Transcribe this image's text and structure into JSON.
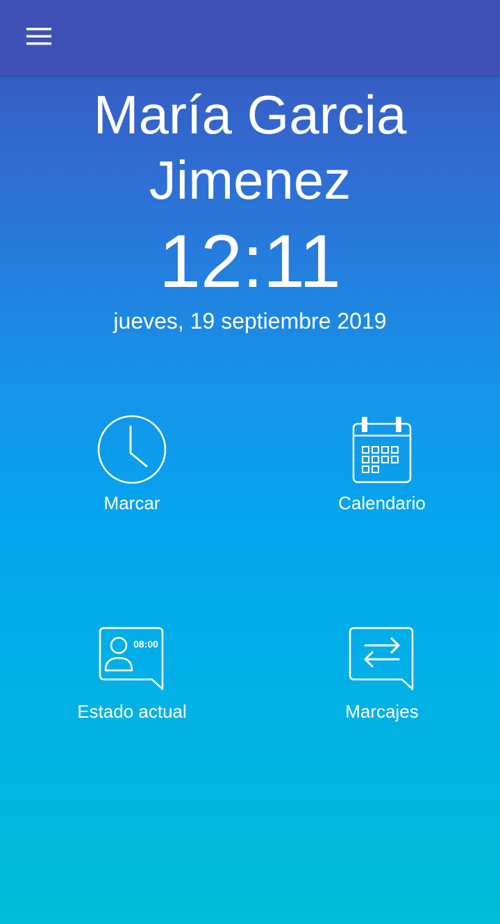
{
  "header": {
    "menu_icon": "hamburger-menu-icon"
  },
  "user": {
    "name": "María Garcia Jimenez"
  },
  "clock": {
    "time": "12:11",
    "date": "jueves, 19 septiembre 2019"
  },
  "icon_time_text": "08:00",
  "tiles": [
    {
      "label": "Marcar",
      "icon": "clock-icon"
    },
    {
      "label": "Calendario",
      "icon": "calendar-icon"
    },
    {
      "label": "Estado actual",
      "icon": "user-status-icon"
    },
    {
      "label": "Marcajes",
      "icon": "swap-arrows-icon"
    }
  ],
  "colors": {
    "appbar": "#3f51b5",
    "gradient_top": "#3a52b8",
    "gradient_mid": "#03a6ef",
    "gradient_bottom": "#00bcd6",
    "foreground": "#ffffff"
  }
}
